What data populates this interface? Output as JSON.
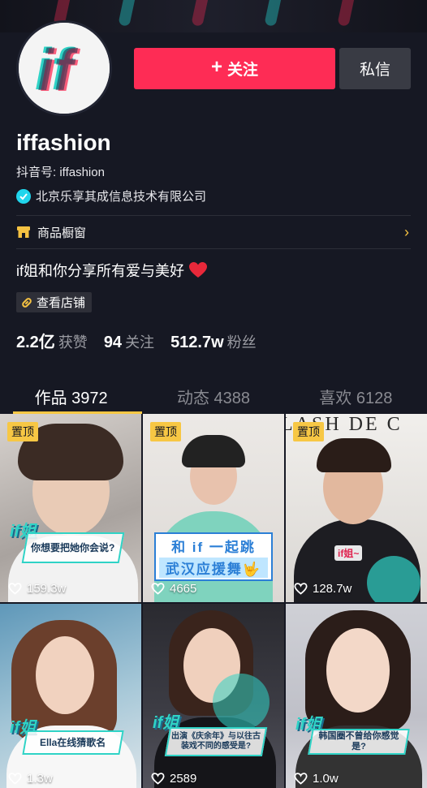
{
  "profile": {
    "username": "iffashion",
    "douyin_id": "抖音号: iffashion",
    "verification": "北京乐享其成信息技术有限公司",
    "bio": "if姐和你分享所有爱与美好",
    "store_tag": "查看店铺",
    "avatar_text": "if"
  },
  "actions": {
    "follow_label": "关注",
    "message_label": "私信"
  },
  "shop": {
    "label": "商品橱窗"
  },
  "stats": [
    {
      "value": "2.2亿",
      "label": "获赞"
    },
    {
      "value": "94",
      "label": "关注"
    },
    {
      "value": "512.7w",
      "label": "粉丝"
    }
  ],
  "tabs": [
    {
      "label": "作品 3972",
      "active": true
    },
    {
      "label": "动态 4388",
      "active": false
    },
    {
      "label": "喜欢 6128",
      "active": false
    }
  ],
  "videos": [
    {
      "pinned": "置顶",
      "likes": "159.3w",
      "caption": "你想要把她你会说?",
      "tag": "if姐"
    },
    {
      "pinned": "置顶",
      "likes": "4665",
      "caption1": "和 if 一起跳",
      "caption2": "武汉应援舞🤟"
    },
    {
      "pinned": "置顶",
      "likes": "128.7w",
      "caption": "if姐~",
      "bg_text": "LASH DE C"
    },
    {
      "likes": "1.3w",
      "caption": "Ella在线猜歌名",
      "tag": "if姐"
    },
    {
      "likes": "2589",
      "caption": "出演《庆余年》与以往古装戏不同的感受是?",
      "tag": "if姐"
    },
    {
      "likes": "1.0w",
      "caption": "韩国圈不曾给你感觉是?",
      "tag": "if姐"
    }
  ],
  "colors": {
    "background": "#161823",
    "accent": "#fe2c55",
    "highlight": "#f7c744",
    "verified": "#20d5ec"
  }
}
